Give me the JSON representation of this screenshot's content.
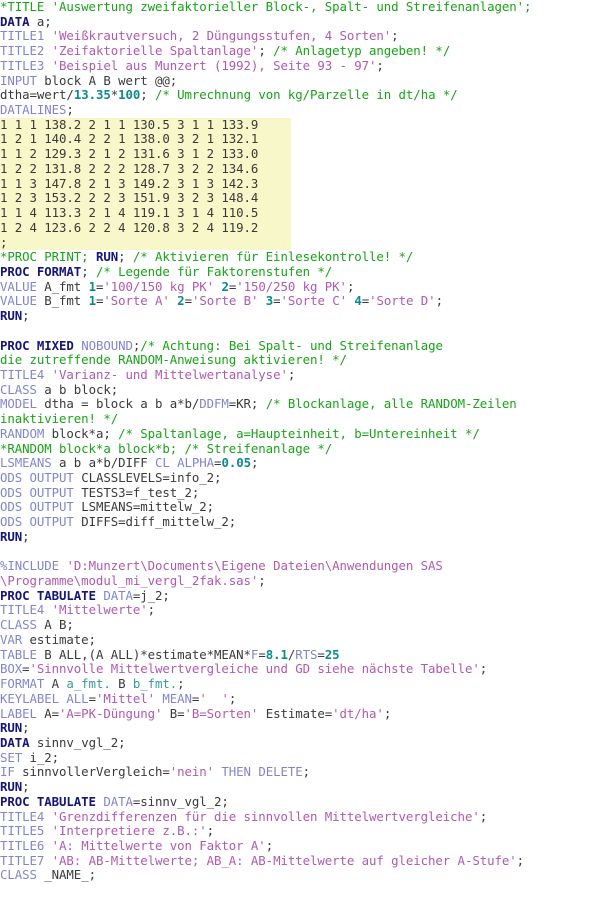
{
  "editor": {
    "app": "SAS Program Editor",
    "language": "SAS",
    "colors": {
      "background": "#ffffff",
      "comment": "#19a319",
      "keyword_bold": "#15157a",
      "keyword_statement": "#8186cc",
      "string": "#b05ab0",
      "number": "#0d8b8b",
      "plain": "#3a3a3a",
      "datalines_highlight": "#f7f7c9"
    }
  },
  "lines": [
    {
      "n": 1,
      "html": "<span class=\"c\">*TITLE 'Auswertung zweifaktorieller Block-, Spalt- und Streifenanlagen';</span>"
    },
    {
      "n": 2,
      "html": "<span class=\"kb\">DATA</span><span class=\"p\"> a;</span>"
    },
    {
      "n": 3,
      "html": "<span class=\"k\">TITLE1</span><span class=\"p\"> </span><span class=\"s\">'Wei&#223;krautversuch, 2 D&#252;ngungsstufen, 4 Sorten'</span><span class=\"p\">;</span>"
    },
    {
      "n": 4,
      "html": "<span class=\"k\">TITLE2</span><span class=\"p\"> </span><span class=\"s\">'Zeifaktorielle Spaltanlage'</span><span class=\"p\">; </span><span class=\"c\">/* Anlagetyp angeben! */</span>"
    },
    {
      "n": 5,
      "html": "<span class=\"k\">TITLE3</span><span class=\"p\"> </span><span class=\"s\">'Beispiel aus Munzert (1992), Seite 93 - 97'</span><span class=\"p\">;</span>"
    },
    {
      "n": 6,
      "html": "<span class=\"k\">INPUT</span><span class=\"p\"> block A B wert @@;</span>"
    },
    {
      "n": 7,
      "html": "<span class=\"p\">dtha=wert/</span><span class=\"n\">13.35</span><span class=\"p\">*</span><span class=\"n\">100</span><span class=\"p\">; </span><span class=\"c\">/* Umrechnung von kg/Parzelle in dt/ha */</span>"
    },
    {
      "n": 8,
      "html": "<span class=\"k\">DATALINES</span><span class=\"p\">;</span>"
    },
    {
      "n": 9,
      "hl": true,
      "html": "<span class=\"p\">1 1 1 138.2 2 1 1 130.5 3 1 1 133.9</span>"
    },
    {
      "n": 10,
      "hl": true,
      "html": "<span class=\"p\">1 2 1 140.4 2 2 1 138.0 3 2 1 132.1</span>"
    },
    {
      "n": 11,
      "hl": true,
      "html": "<span class=\"p\">1 1 2 129.3 2 1 2 131.6 3 1 2 133.0</span>"
    },
    {
      "n": 12,
      "hl": true,
      "html": "<span class=\"p\">1 2 2 131.8 2 2 2 128.7 3 2 2 134.6</span>"
    },
    {
      "n": 13,
      "hl": true,
      "html": "<span class=\"p\">1 1 3 147.8 2 1 3 149.2 3 1 3 142.3</span>"
    },
    {
      "n": 14,
      "hl": true,
      "html": "<span class=\"p\">1 2 3 153.2 2 2 3 151.9 3 2 3 148.4</span>"
    },
    {
      "n": 15,
      "hl": true,
      "html": "<span class=\"p\">1 1 4 113.3 2 1 4 119.1 3 1 4 110.5</span>"
    },
    {
      "n": 16,
      "hl": true,
      "html": "<span class=\"p\">1 2 4 123.6 2 2 4 120.8 3 2 4 119.2</span>"
    },
    {
      "n": 17,
      "hl": true,
      "html": "<span class=\"p\">;</span>"
    },
    {
      "n": 18,
      "html": "<span class=\"c\">*PROC PRINT; </span><span class=\"kb\">RUN</span><span class=\"p\">; </span><span class=\"c\">/* Aktivieren f&#252;r Einlesekontrolle! */</span>"
    },
    {
      "n": 19,
      "html": "<span class=\"kb\">PROC FORMAT</span><span class=\"p\">; </span><span class=\"c\">/* Legende f&#252;r Faktorenstufen */</span>"
    },
    {
      "n": 20,
      "html": "<span class=\"k\">VALUE</span><span class=\"p\"> A_fmt </span><span class=\"n\">1</span><span class=\"p\">=</span><span class=\"s\">'100/150 kg PK'</span><span class=\"p\"> </span><span class=\"n\">2</span><span class=\"p\">=</span><span class=\"s\">'150/250 kg PK'</span><span class=\"p\">;</span>"
    },
    {
      "n": 21,
      "html": "<span class=\"k\">VALUE</span><span class=\"p\"> B_fmt </span><span class=\"n\">1</span><span class=\"p\">=</span><span class=\"s\">'Sorte A'</span><span class=\"p\"> </span><span class=\"n\">2</span><span class=\"p\">=</span><span class=\"s\">'Sorte B'</span><span class=\"p\"> </span><span class=\"n\">3</span><span class=\"p\">=</span><span class=\"s\">'Sorte C'</span><span class=\"p\"> </span><span class=\"n\">4</span><span class=\"p\">=</span><span class=\"s\">'Sorte D'</span><span class=\"p\">;</span>"
    },
    {
      "n": 22,
      "html": "<span class=\"kb\">RUN</span><span class=\"p\">;</span>"
    },
    {
      "n": 23,
      "html": "<span class=\"p\">&nbsp;</span>"
    },
    {
      "n": 24,
      "html": "<span class=\"kb\">PROC MIXED</span><span class=\"p\"> </span><span class=\"k\">NOBOUND</span><span class=\"p\">;</span><span class=\"c\">/* Achtung: Bei Spalt- und Streifenanlage</span>"
    },
    {
      "n": 25,
      "html": "<span class=\"c\">die zutreffende RANDOM-Anweisung aktivieren! */</span>"
    },
    {
      "n": 26,
      "html": "<span class=\"k\">TITLE4</span><span class=\"p\"> </span><span class=\"s\">'Varianz- und Mittelwertanalyse'</span><span class=\"p\">;</span>"
    },
    {
      "n": 27,
      "html": "<span class=\"k\">CLASS</span><span class=\"p\"> a b block;</span>"
    },
    {
      "n": 28,
      "html": "<span class=\"k\">MODEL</span><span class=\"p\"> dtha = block a b a*b/</span><span class=\"k\">DDFM</span><span class=\"p\">=KR; </span><span class=\"c\">/* Blockanlage, alle RANDOM-Zeilen</span>"
    },
    {
      "n": 29,
      "html": "<span class=\"c\">inaktivieren! */</span>"
    },
    {
      "n": 30,
      "html": "<span class=\"k\">RANDOM</span><span class=\"p\"> block*a; </span><span class=\"c\">/* Spaltanlage, a=Haupteinheit, b=Untereinheit */</span>"
    },
    {
      "n": 31,
      "html": "<span class=\"c\">*RANDOM block*a block*b; /* Streifenanlage */</span>"
    },
    {
      "n": 32,
      "html": "<span class=\"k\">LSMEANS</span><span class=\"p\"> a b a*b/DIFF </span><span class=\"k\">CL ALPHA</span><span class=\"p\">=</span><span class=\"n\">0.05</span><span class=\"p\">;</span>"
    },
    {
      "n": 33,
      "html": "<span class=\"k\">ODS OUTPUT</span><span class=\"p\"> CLASSLEVELS=info_2;</span>"
    },
    {
      "n": 34,
      "html": "<span class=\"k\">ODS OUTPUT</span><span class=\"p\"> TESTS3=f_test_2;</span>"
    },
    {
      "n": 35,
      "html": "<span class=\"k\">ODS OUTPUT</span><span class=\"p\"> LSMEANS=mittelw_2;</span>"
    },
    {
      "n": 36,
      "html": "<span class=\"k\">ODS OUTPUT</span><span class=\"p\"> DIFFS=diff_mittelw_2;</span>"
    },
    {
      "n": 37,
      "html": "<span class=\"kb\">RUN</span><span class=\"p\">;</span>"
    },
    {
      "n": 38,
      "html": "<span class=\"p\">&nbsp;</span>"
    },
    {
      "n": 39,
      "html": "<span class=\"k\">%INCLUDE</span><span class=\"p\"> </span><span class=\"s\">'D:Munzert\\Documents\\Eigene Dateien\\Anwendungen SAS</span>"
    },
    {
      "n": 40,
      "html": "<span class=\"s\">\\Programme\\modul_mi_vergl_2fak.sas'</span><span class=\"p\">;</span>"
    },
    {
      "n": 41,
      "html": "<span class=\"kb\">PROC TABULATE</span><span class=\"p\"> </span><span class=\"k\">DATA</span><span class=\"p\">=j_2;</span>"
    },
    {
      "n": 42,
      "html": "<span class=\"k\">TITLE4</span><span class=\"p\"> </span><span class=\"s\">'Mittelwerte'</span><span class=\"p\">;</span>"
    },
    {
      "n": 43,
      "html": "<span class=\"k\">CLASS</span><span class=\"p\"> A B;</span>"
    },
    {
      "n": 44,
      "html": "<span class=\"k\">VAR</span><span class=\"p\"> estimate;</span>"
    },
    {
      "n": 45,
      "html": "<span class=\"k\">TABLE</span><span class=\"p\"> B ALL,(A ALL)*estimate*MEAN*</span><span class=\"k\">F</span><span class=\"p\">=</span><span class=\"n\">8.1</span><span class=\"p\">/</span><span class=\"k\">RTS</span><span class=\"p\">=</span><span class=\"n\">25</span>"
    },
    {
      "n": 46,
      "html": "<span class=\"k\">BOX</span><span class=\"p\">=</span><span class=\"s\">'Sinnvolle Mittelwertvergleiche und GD siehe n&#228;chste Tabelle'</span><span class=\"p\">;</span>"
    },
    {
      "n": 47,
      "html": "<span class=\"k\">FORMAT</span><span class=\"p\"> A </span><span class=\"f\">a_fmt.</span><span class=\"p\"> B </span><span class=\"f\">b_fmt.</span><span class=\"p\">;</span>"
    },
    {
      "n": 48,
      "html": "<span class=\"k\">KEYLABEL ALL</span><span class=\"p\">=</span><span class=\"s\">'Mittel'</span><span class=\"p\"> </span><span class=\"k\">MEAN</span><span class=\"p\">=</span><span class=\"s\">'  '</span><span class=\"p\">;</span>"
    },
    {
      "n": 49,
      "html": "<span class=\"k\">LABEL</span><span class=\"p\"> A=</span><span class=\"s\">'A=PK-D&#252;ngung'</span><span class=\"p\"> B=</span><span class=\"s\">'B=Sorten'</span><span class=\"p\"> Estimate=</span><span class=\"s\">'dt/ha'</span><span class=\"p\">;</span>"
    },
    {
      "n": 50,
      "html": "<span class=\"kb\">RUN</span><span class=\"p\">;</span>"
    },
    {
      "n": 51,
      "html": "<span class=\"kb\">DATA</span><span class=\"p\"> sinnv_vgl_2;</span>"
    },
    {
      "n": 52,
      "html": "<span class=\"k\">SET</span><span class=\"p\"> i_2;</span>"
    },
    {
      "n": 53,
      "html": "<span class=\"k\">IF</span><span class=\"p\"> sinnvollerVergleich=</span><span class=\"s\">'nein'</span><span class=\"p\"> </span><span class=\"k\">THEN DELETE</span><span class=\"p\">;</span>"
    },
    {
      "n": 54,
      "html": "<span class=\"kb\">RUN</span><span class=\"p\">;</span>"
    },
    {
      "n": 55,
      "html": "<span class=\"kb\">PROC TABULATE</span><span class=\"p\"> </span><span class=\"k\">DATA</span><span class=\"p\">=sinnv_vgl_2;</span>"
    },
    {
      "n": 56,
      "html": "<span class=\"k\">TITLE4</span><span class=\"p\"> </span><span class=\"s\">'Grenzdifferenzen f&#252;r die sinnvollen Mittelwertvergleiche'</span><span class=\"p\">;</span>"
    },
    {
      "n": 57,
      "html": "<span class=\"k\">TITLE5</span><span class=\"p\"> </span><span class=\"s\">'Interpretiere z.B.:'</span><span class=\"p\">;</span>"
    },
    {
      "n": 58,
      "html": "<span class=\"k\">TITLE6</span><span class=\"p\"> </span><span class=\"s\">'A: Mittelwerte von Faktor A'</span><span class=\"p\">;</span>"
    },
    {
      "n": 59,
      "html": "<span class=\"k\">TITLE7</span><span class=\"p\"> </span><span class=\"s\">'AB: AB-Mittelwerte; AB_A: AB-Mittelwerte auf gleicher A-Stufe'</span><span class=\"p\">;</span>"
    },
    {
      "n": 60,
      "html": "<span class=\"k\">CLASS</span><span class=\"p\"> _NAME_;</span>"
    }
  ]
}
